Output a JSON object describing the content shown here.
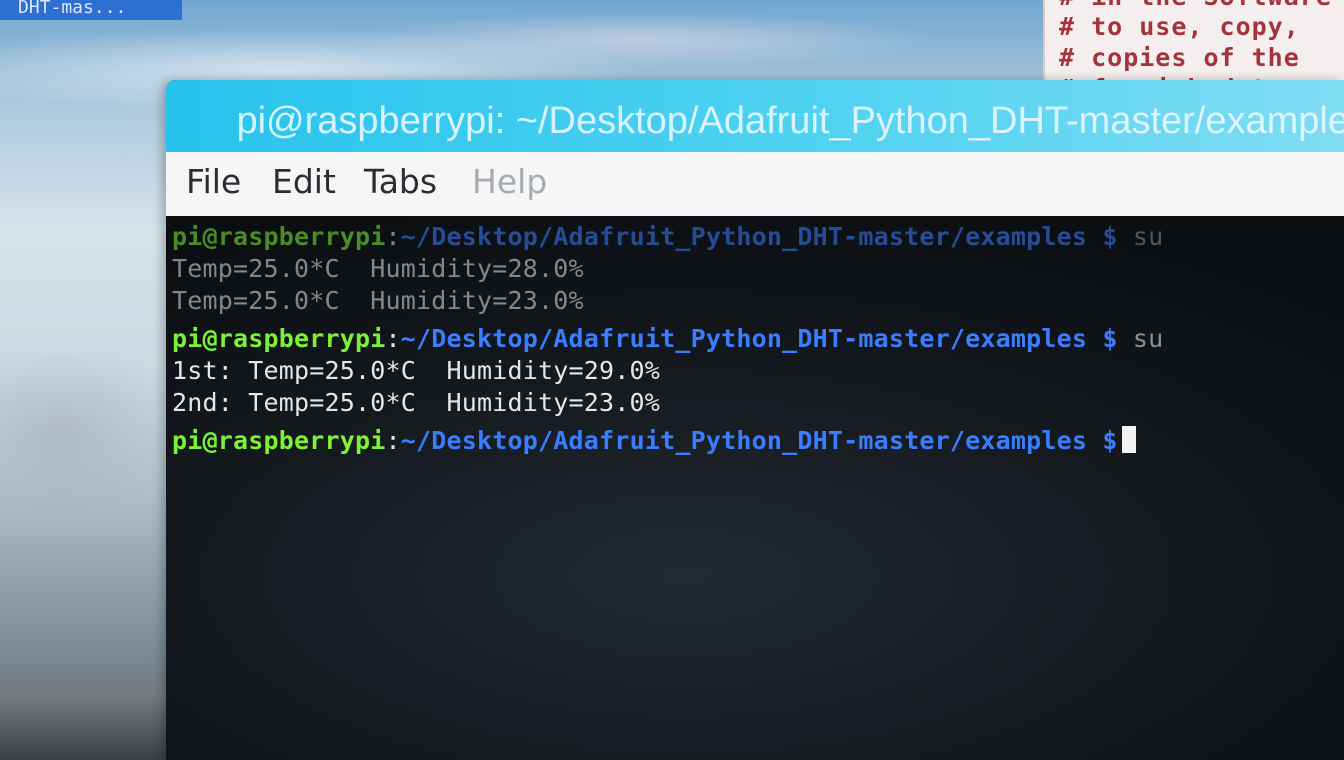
{
  "desktop": {
    "icon_label": "DHT-mas..."
  },
  "editor": {
    "lines": [
      "# in the Software",
      "# to use, copy,",
      "# copies of the",
      "# furnished to"
    ]
  },
  "terminal": {
    "title": "pi@raspberrypi: ~/Desktop/Adafruit_Python_DHT-master/examples",
    "menu": {
      "file": "File",
      "edit": "Edit",
      "tabs": "Tabs",
      "help": "Help"
    },
    "lines": [
      {
        "user": "pi@raspberrypi",
        "colon": ":",
        "path": "~/Desktop/Adafruit_Python_DHT-master/examples $",
        "cmd": " su"
      },
      {
        "output": "Temp=25.0*C  Humidity=28.0%"
      },
      {
        "output": "Temp=25.0*C  Humidity=23.0%"
      },
      {
        "user": "pi@raspberrypi",
        "colon": ":",
        "path": "~/Desktop/Adafruit_Python_DHT-master/examples $",
        "cmd": " su"
      },
      {
        "output": "1st: Temp=25.0*C  Humidity=29.0%"
      },
      {
        "output": "2nd: Temp=25.0*C  Humidity=23.0%"
      },
      {
        "user": "pi@raspberrypi",
        "colon": ":",
        "path": "~/Desktop/Adafruit_Python_DHT-master/examples $",
        "cmd": ""
      }
    ]
  },
  "colors": {
    "titlebar": "#27c3ec",
    "prompt_user": "#7cf237",
    "prompt_path": "#3a7dff",
    "terminal_bg": "#14191e"
  }
}
